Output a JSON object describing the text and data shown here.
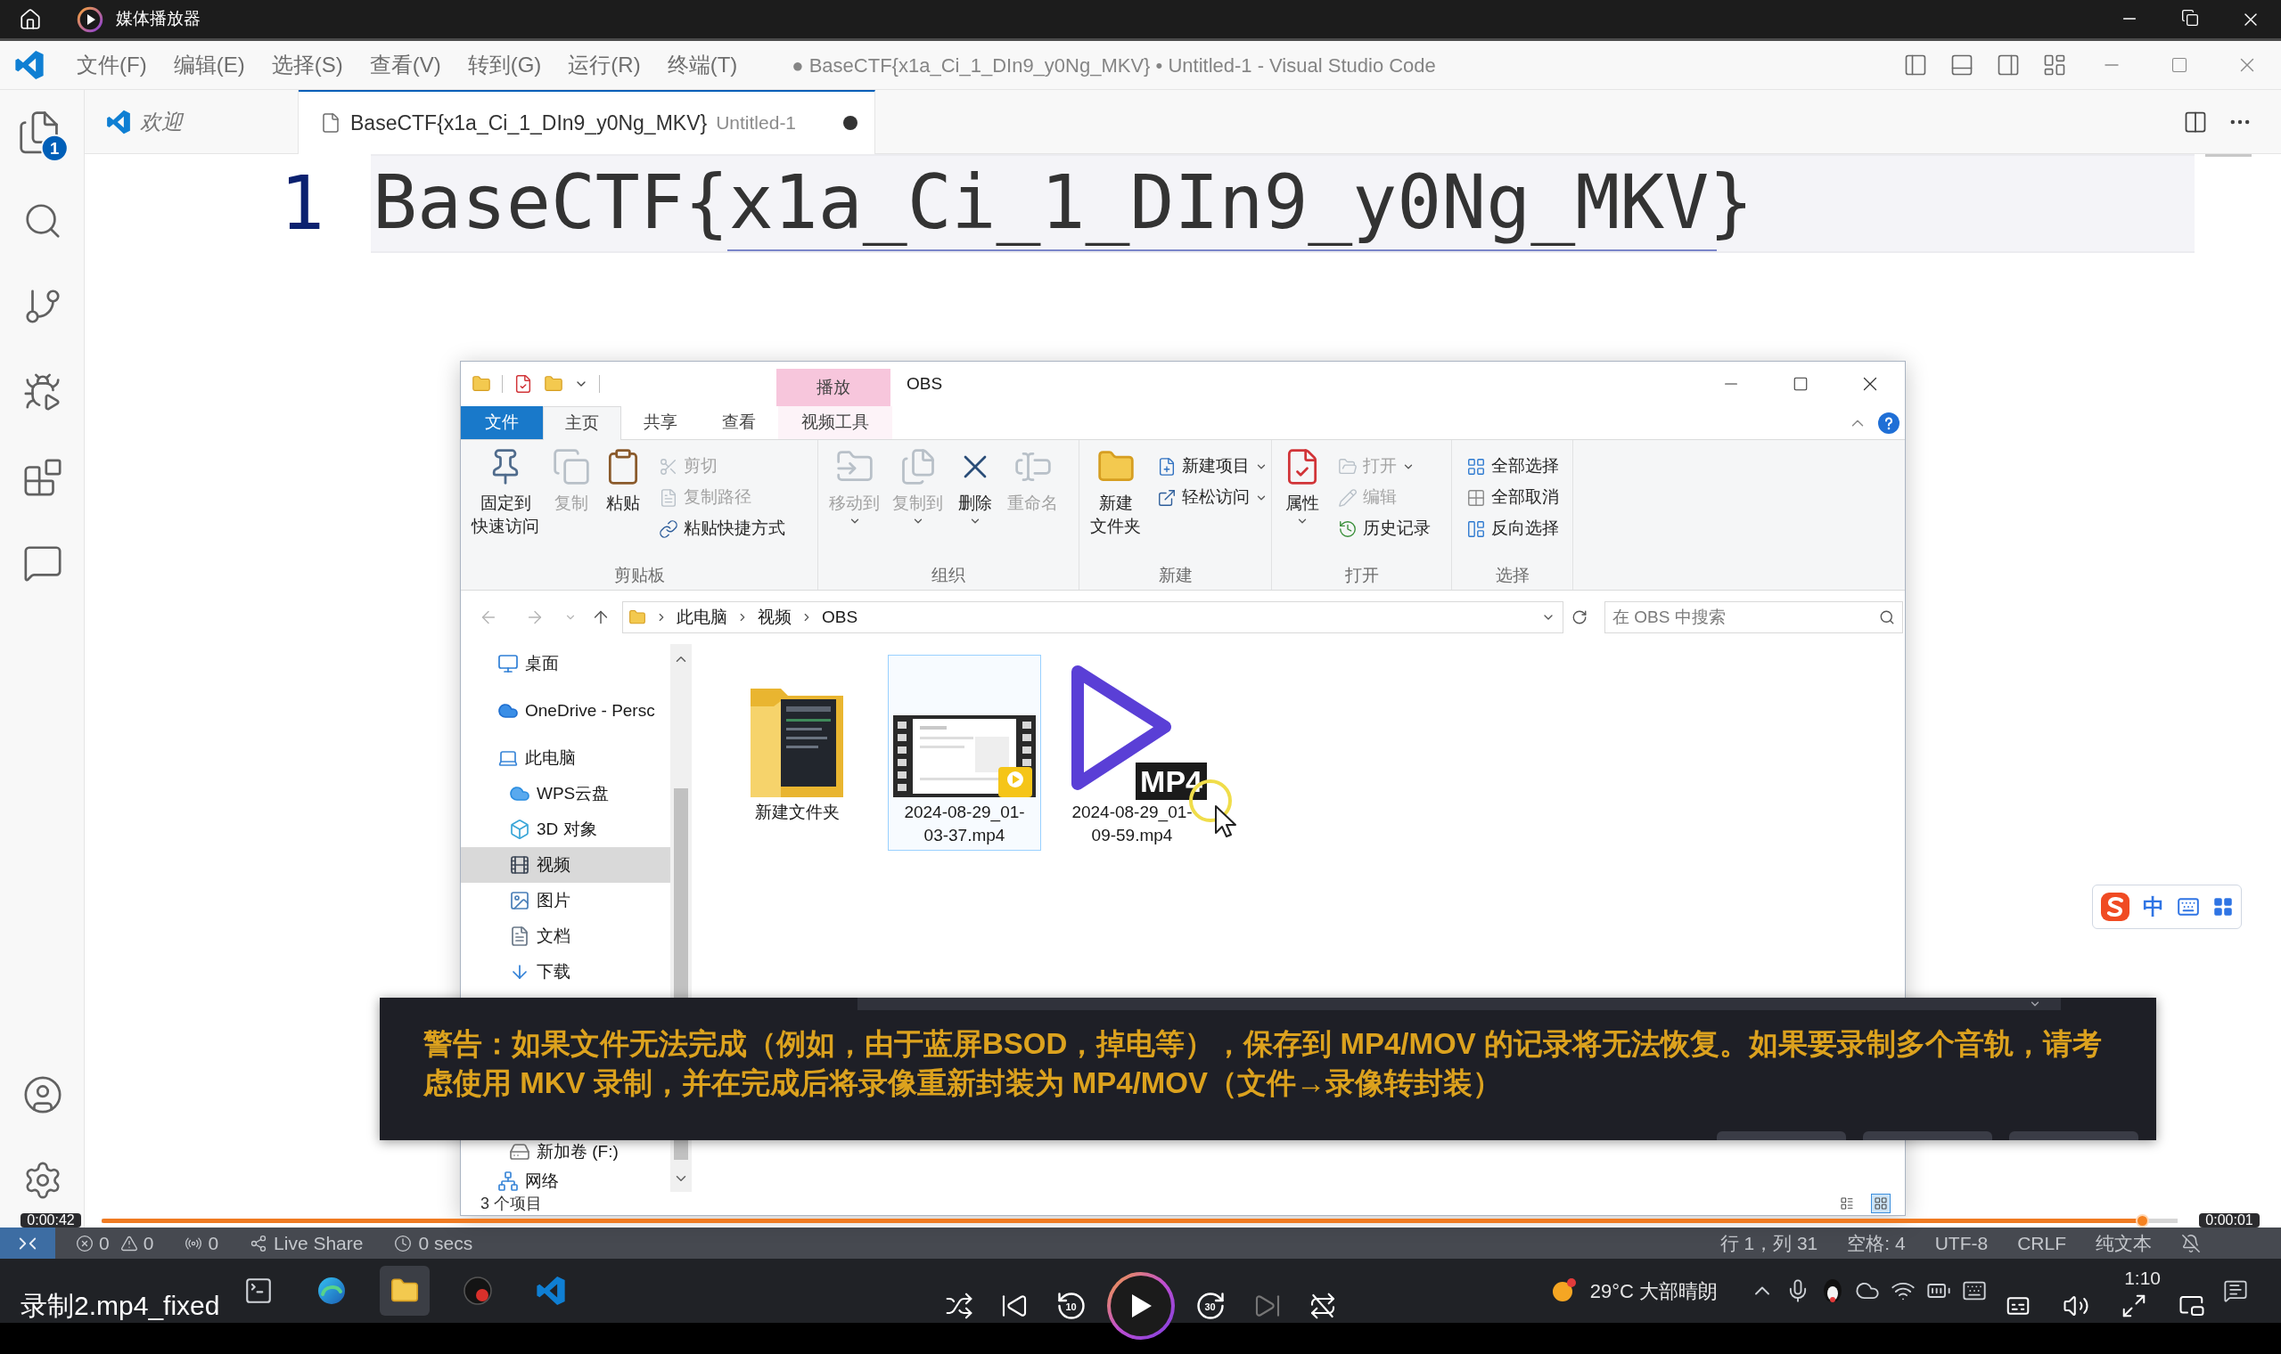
{
  "player": {
    "title": "媒体播放器",
    "video_title": "录制2.mp4_fixed",
    "elapsed": "0:00:42",
    "remaining": "0:00:01",
    "level": 0.983,
    "controls": [
      {
        "kind": "shuffle",
        "disabled": false
      },
      {
        "kind": "previous",
        "disabled": false
      },
      {
        "kind": "rewind",
        "label": "10",
        "disabled": false
      },
      {
        "kind": "play",
        "disabled": false
      },
      {
        "kind": "forward",
        "label": "30",
        "disabled": false
      },
      {
        "kind": "next",
        "disabled": true
      },
      {
        "kind": "repeat",
        "disabled": false
      }
    ],
    "side_controls": [
      {
        "kind": "captions"
      },
      {
        "kind": "volume"
      },
      {
        "kind": "fullscreen"
      },
      {
        "kind": "mini-player"
      }
    ]
  },
  "vscode": {
    "menu": [
      "文件(F)",
      "编辑(E)",
      "选择(S)",
      "查看(V)",
      "转到(G)",
      "运行(R)",
      "终端(T)"
    ],
    "title": "● BaseCTF{x1a_Ci_1_DIn9_y0Ng_MKV} • Untitled-1 - Visual Studio Code",
    "activity_top": [
      {
        "kind": "explorer",
        "badge": "1"
      },
      {
        "kind": "search"
      },
      {
        "kind": "source-control"
      },
      {
        "kind": "run"
      },
      {
        "kind": "extensions"
      },
      {
        "kind": "remote-explorer"
      }
    ],
    "activity_bottom": [
      {
        "kind": "accounts"
      },
      {
        "kind": "settings"
      }
    ],
    "tabs": [
      {
        "kind": "welcome",
        "label": "欢迎",
        "selected": false,
        "dirty": false
      },
      {
        "kind": "file",
        "label": "BaseCTF{x1a_Ci_1_DIn9_y0Ng_MKV}",
        "description": "Untitled-1",
        "selected": true,
        "dirty": true
      }
    ],
    "lines": [
      {
        "number": "1",
        "text": "BaseCTF{x1a_Ci_1_DIn9_y0Ng_MKV}",
        "current": true
      }
    ],
    "status_left": [
      {
        "kind": "remote"
      },
      {
        "kind": "problems",
        "errors": "0",
        "warnings": "0"
      },
      {
        "kind": "ports",
        "text": "0"
      },
      {
        "kind": "live-share",
        "text": "Live Share"
      },
      {
        "kind": "timer",
        "text": "0 secs"
      }
    ],
    "status_right": [
      {
        "kind": "text",
        "text": "行 1，列 31"
      },
      {
        "kind": "text",
        "text": "空格: 4"
      },
      {
        "kind": "text",
        "text": "UTF-8"
      },
      {
        "kind": "text",
        "text": "CRLF"
      },
      {
        "kind": "text",
        "text": "纯文本"
      },
      {
        "kind": "notifications"
      }
    ]
  },
  "explorer": {
    "title": "OBS",
    "context_header": "播放",
    "quick_access": [
      {
        "kind": "folder"
      },
      {
        "kind": "properties"
      },
      {
        "kind": "folder"
      },
      {
        "kind": "customize"
      }
    ],
    "tabs": [
      {
        "label": "文件",
        "kind": "file",
        "selected": false
      },
      {
        "label": "主页",
        "kind": "tab",
        "selected": true
      },
      {
        "label": "共享",
        "kind": "tab",
        "selected": false
      },
      {
        "label": "查看",
        "kind": "tab",
        "selected": false
      },
      {
        "label": "视频工具",
        "kind": "contextual",
        "selected": false
      }
    ],
    "ribbon": [
      {
        "label": "剪贴板",
        "large": [
          {
            "lines": [
              "固定到",
              "快速访问"
            ],
            "kind": "pin",
            "disabled": false,
            "dropdown": false
          },
          {
            "label": "复制",
            "kind": "copy",
            "disabled": true,
            "dropdown": false
          },
          {
            "label": "粘贴",
            "kind": "paste",
            "disabled": false,
            "dropdown": false
          }
        ],
        "small": [
          {
            "label": "剪切",
            "kind": "cut",
            "disabled": true,
            "dropdown": false
          },
          {
            "label": "复制路径",
            "kind": "copy-path",
            "disabled": true,
            "dropdown": false
          },
          {
            "label": "粘贴快捷方式",
            "kind": "paste-shortcut",
            "disabled": false,
            "dropdown": false
          }
        ]
      },
      {
        "label": "组织",
        "large": [
          {
            "label": "移动到",
            "kind": "move-to",
            "disabled": true,
            "dropdown": true
          },
          {
            "label": "复制到",
            "kind": "copy-to",
            "disabled": true,
            "dropdown": true
          },
          {
            "label": "删除",
            "kind": "delete",
            "disabled": false,
            "dropdown": true
          },
          {
            "label": "重命名",
            "kind": "rename",
            "disabled": true,
            "dropdown": false
          }
        ]
      },
      {
        "label": "新建",
        "large": [
          {
            "lines": [
              "新建",
              "文件夹"
            ],
            "kind": "new-folder",
            "disabled": false,
            "dropdown": false
          }
        ],
        "small": [
          {
            "label": "新建项目",
            "kind": "new-item",
            "disabled": false,
            "dropdown": true
          },
          {
            "label": "轻松访问",
            "kind": "easy-access",
            "disabled": false,
            "dropdown": true
          }
        ]
      },
      {
        "label": "打开",
        "large": [
          {
            "label": "属性",
            "kind": "properties",
            "disabled": false,
            "dropdown": true
          }
        ],
        "small": [
          {
            "label": "打开",
            "kind": "open",
            "disabled": true,
            "dropdown": true
          },
          {
            "label": "编辑",
            "kind": "edit",
            "disabled": true,
            "dropdown": false
          },
          {
            "label": "历史记录",
            "kind": "history",
            "disabled": false,
            "dropdown": false
          }
        ]
      },
      {
        "label": "选择",
        "small": [
          {
            "label": "全部选择",
            "kind": "select-all",
            "disabled": false,
            "dropdown": false
          },
          {
            "label": "全部取消",
            "kind": "select-none",
            "disabled": false,
            "dropdown": false
          },
          {
            "label": "反向选择",
            "kind": "invert-selection",
            "disabled": false,
            "dropdown": false
          }
        ]
      }
    ],
    "path": [
      "此电脑",
      "视频",
      "OBS"
    ],
    "search_placeholder": "在 OBS 中搜索",
    "nav": {
      "items": [
        {
          "label": "桌面",
          "kind": "desktop",
          "selected": false
        },
        {
          "label": "OneDrive - Persc",
          "kind": "onedrive",
          "selected": false
        },
        {
          "label": "此电脑",
          "kind": "pc",
          "selected": false,
          "children": [
            {
              "label": "WPS云盘",
              "kind": "cloud",
              "selected": false
            },
            {
              "label": "3D 对象",
              "kind": "objects",
              "selected": false
            },
            {
              "label": "视频",
              "kind": "videos",
              "selected": true
            },
            {
              "label": "图片",
              "kind": "pictures",
              "selected": false
            },
            {
              "label": "文档",
              "kind": "documents",
              "selected": false
            },
            {
              "label": "下载",
              "kind": "downloads",
              "selected": false
            }
          ]
        }
      ],
      "lower_items": [
        {
          "label": "新加卷 (F:)",
          "kind": "drive",
          "selected": false
        },
        {
          "label": "网络",
          "kind": "network",
          "selected": false
        }
      ]
    },
    "files": [
      {
        "name": "新建文件夹",
        "kind": "folder",
        "selected": false
      },
      {
        "name": "2024-08-29_01-03-37.mp4",
        "kind": "video",
        "selected": true
      },
      {
        "name": "2024-08-29_01-09-59.mp4",
        "kind": "mp4",
        "badge": "MP4",
        "selected": false
      }
    ],
    "status": "3 个项目",
    "views": [
      {
        "kind": "details",
        "selected": false
      },
      {
        "kind": "large-icons",
        "selected": true
      }
    ]
  },
  "warning": {
    "text": "警告：如果文件无法完成（例如，由于蓝屏BSOD，掉电等），保存到 MP4/MOV 的记录将无法恢复。如果要录制多个音轨，请考虑使用 MKV 录制，并在完成后将录像重新封装为 MP4/MOV（文件→录像转封装）"
  },
  "ime": {
    "mode": "中"
  },
  "taskbar": {
    "apps": [
      {
        "kind": "terminal",
        "selected": false
      },
      {
        "kind": "browser",
        "selected": false
      },
      {
        "kind": "files",
        "selected": true
      },
      {
        "kind": "app",
        "selected": false
      },
      {
        "kind": "editor",
        "selected": false
      }
    ],
    "weather": "29°C 大部晴朗",
    "tray": [
      {
        "kind": "chevron"
      },
      {
        "kind": "mic"
      },
      {
        "kind": "penguin"
      },
      {
        "kind": "cloud"
      },
      {
        "kind": "wifi"
      },
      {
        "kind": "battery"
      },
      {
        "kind": "keyboard"
      }
    ],
    "time": "1:10"
  }
}
